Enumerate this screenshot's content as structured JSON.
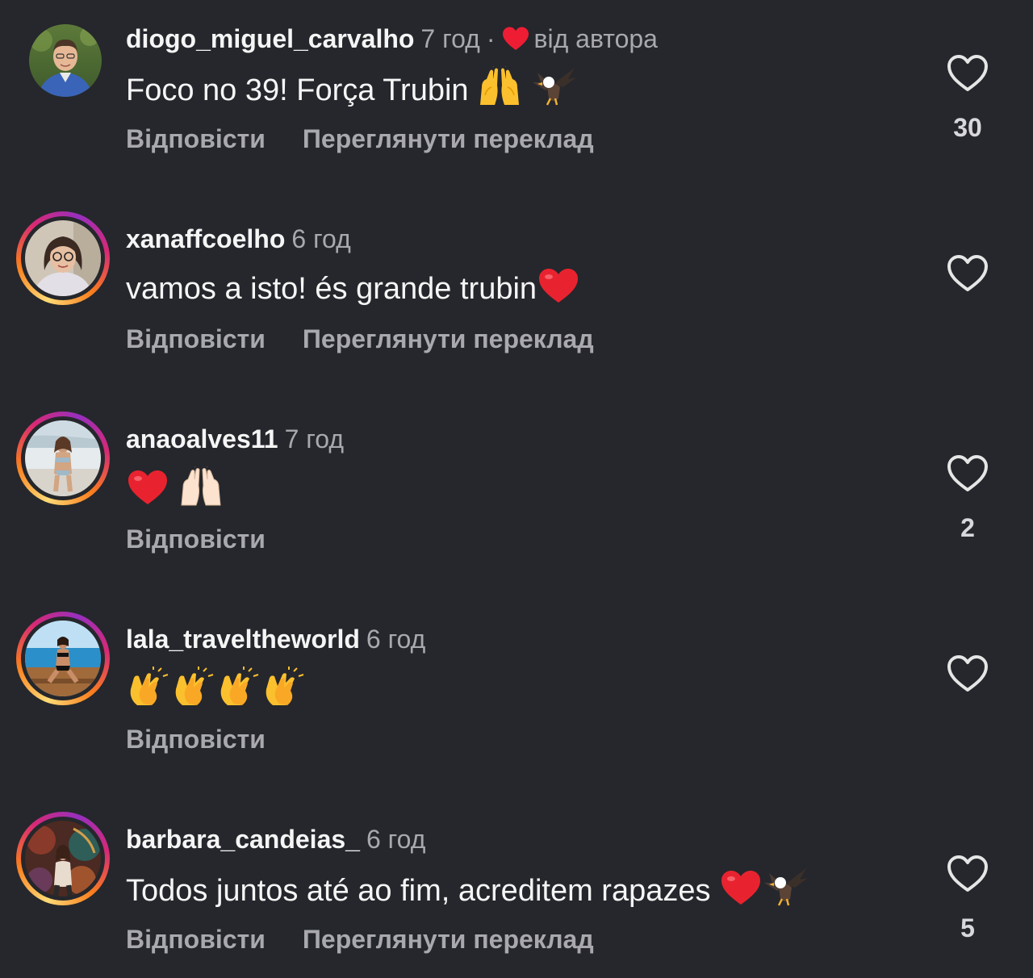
{
  "colors": {
    "background": "#25272c",
    "primary_text": "#f5f5f5",
    "secondary_text": "#a8a8ad",
    "heart_red": "#ee1d34"
  },
  "comments": [
    {
      "username": "diogo_miguel_carvalho",
      "time": "7 год",
      "separator": "·",
      "author_liked_label": "від автора",
      "text": "Foco no 39! Força Trubin",
      "emojis": [
        "raising-hands-emoji",
        "eagle-emoji"
      ],
      "reply": "Відповісти",
      "translate": "Переглянути переклад",
      "likes": "30",
      "avatar": "avatar-photo-man"
    },
    {
      "username": "xanaffcoelho",
      "time": "6 год",
      "text": "vamos a isto! és grande trubin",
      "emojis": [
        "red-heart-emoji"
      ],
      "reply": "Відповісти",
      "translate": "Переглянути переклад",
      "likes": "",
      "avatar": "avatar-photo-woman-glasses"
    },
    {
      "username": "anaoalves11",
      "time": "7 год",
      "text": "",
      "emojis": [
        "red-heart-emoji",
        "raising-hands-light-emoji"
      ],
      "reply": "Відповісти",
      "translate": "",
      "likes": "2",
      "avatar": "avatar-photo-beach"
    },
    {
      "username": "lala_traveltheworld",
      "time": "6 год",
      "text": "",
      "emojis": [
        "clapping-hands-emoji",
        "clapping-hands-emoji",
        "clapping-hands-emoji",
        "clapping-hands-emoji"
      ],
      "reply": "Відповісти",
      "translate": "",
      "likes": "",
      "avatar": "avatar-photo-pool"
    },
    {
      "username": "barbara_candeias_",
      "time": "6 год",
      "text": "Todos juntos até ao fim, acreditem rapazes",
      "emojis": [
        "red-heart-emoji",
        "eagle-emoji"
      ],
      "reply": "Відповісти",
      "translate": "Переглянути переклад",
      "likes": "5",
      "avatar": "avatar-photo-mural"
    }
  ]
}
